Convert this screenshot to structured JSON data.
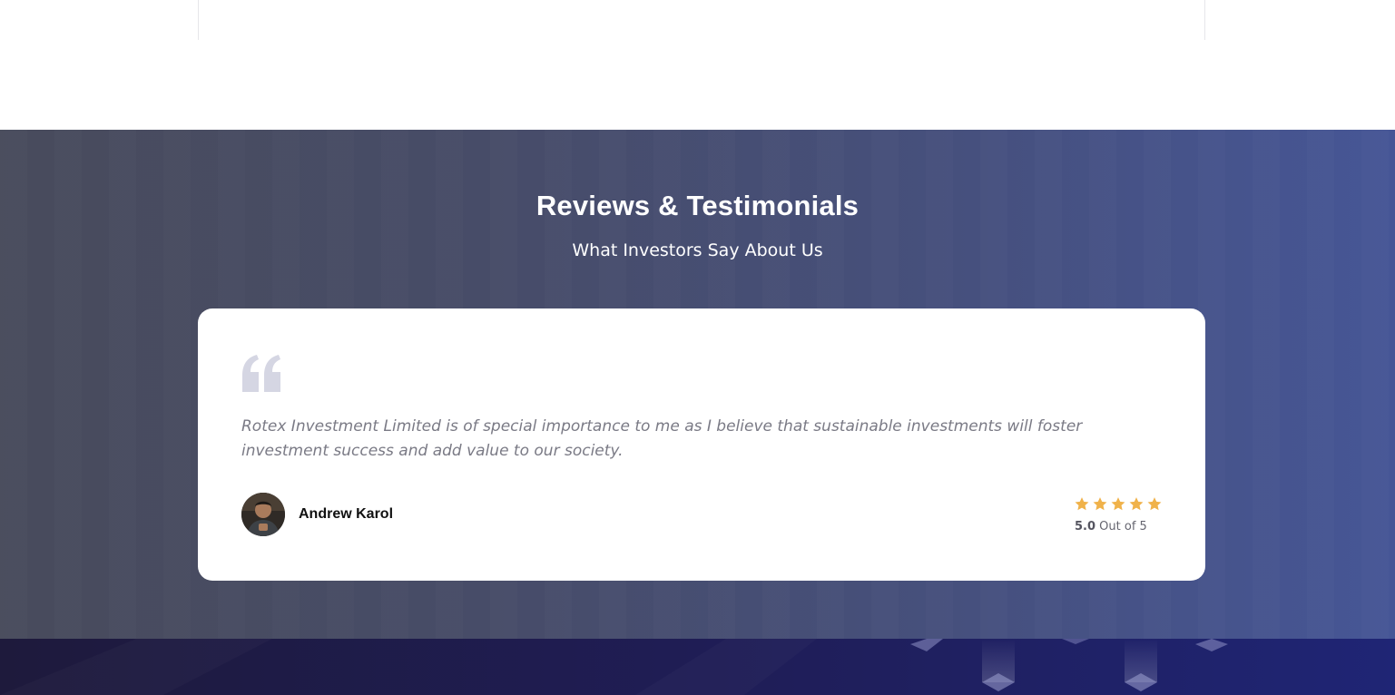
{
  "section": {
    "title": "Reviews & Testimonials",
    "subtitle": "What Investors Say About Us"
  },
  "testimonial": {
    "quote_icon": "quote-icon",
    "text": "Rotex Investment Limited is of special importance to me as I believe that sustainable investments will foster investment success and add value to our society.",
    "author": {
      "name": "Andrew Karol",
      "avatar": "avatar"
    },
    "rating": {
      "score": "5.0",
      "suffix": " Out of 5",
      "stars": 5,
      "max_stars": 5,
      "star_color": "#f0b24a"
    }
  },
  "colors": {
    "section_bg_start": "#484b5c",
    "section_bg_end": "#465696",
    "footer_bg": "#1f1d55",
    "quote_icon": "#d5d6e3"
  }
}
